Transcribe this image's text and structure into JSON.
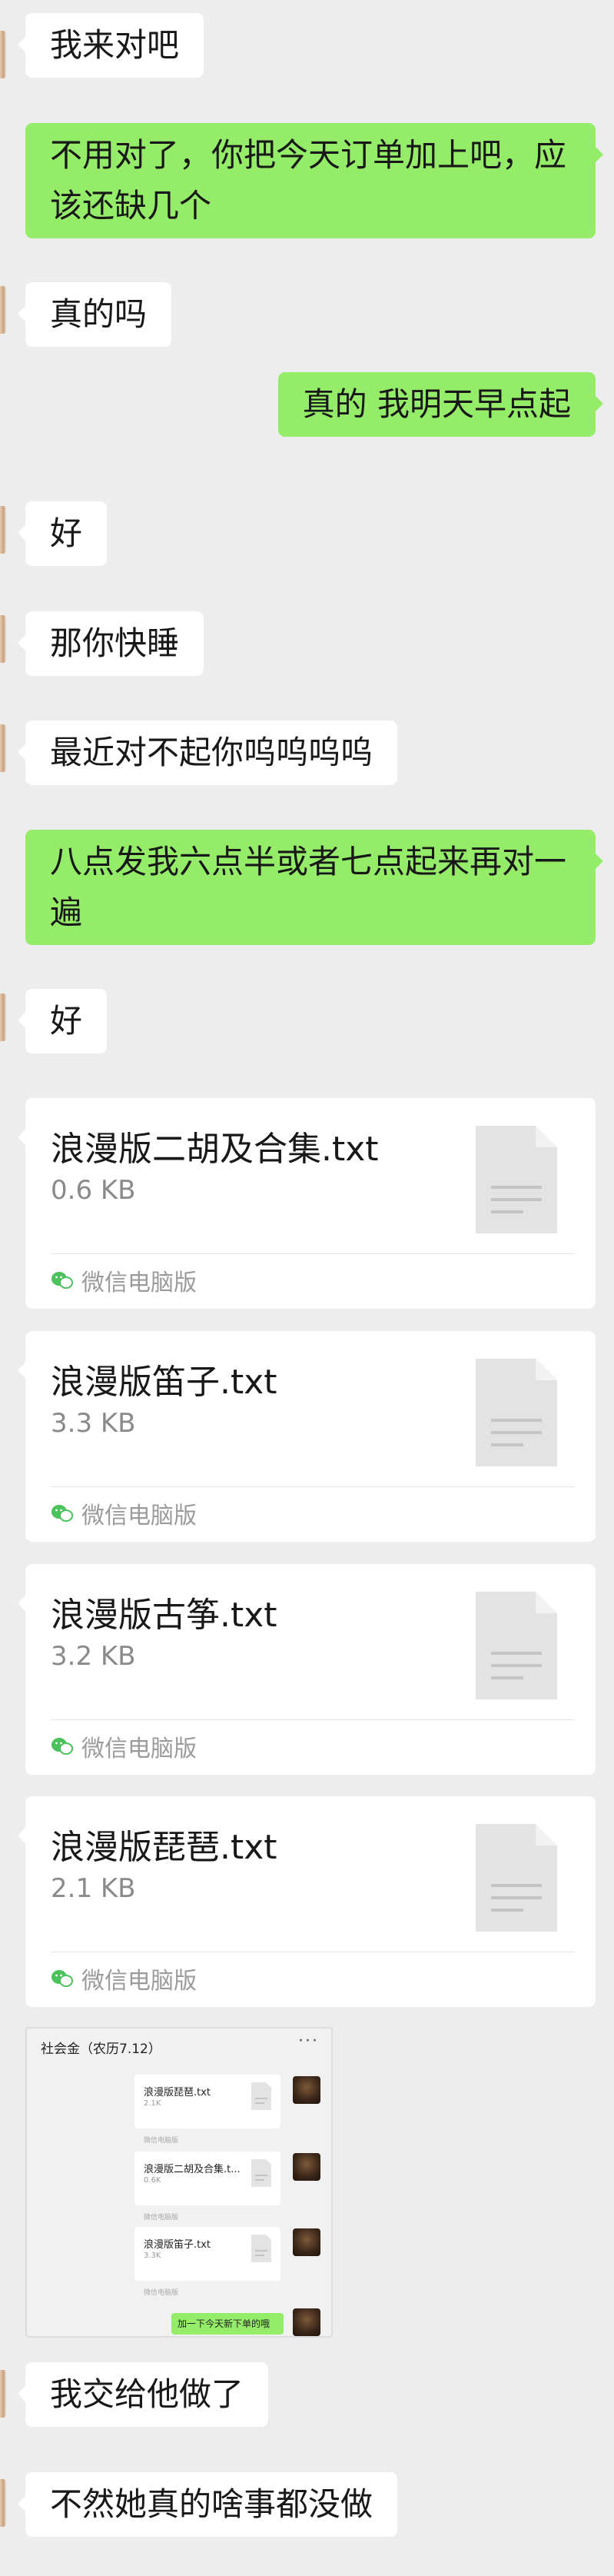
{
  "messages": [
    {
      "text": "我来对吧"
    },
    {
      "text": "不用对了，你把今天订单加上吧，应该还缺几个"
    },
    {
      "text": "真的吗"
    },
    {
      "text": "真的 我明天早点起"
    },
    {
      "text": "好"
    },
    {
      "text": "那你快睡"
    },
    {
      "text": "最近对不起你呜呜呜呜"
    },
    {
      "text": "八点发我六点半或者七点起来再对一遍"
    },
    {
      "text": "好"
    },
    {
      "text": "我交给他做了"
    },
    {
      "text": "不然她真的啥事都没做"
    }
  ],
  "files": [
    {
      "name": "浪漫版二胡及合集.txt",
      "size": "0.6 KB",
      "source": "微信电脑版"
    },
    {
      "name": "浪漫版笛子.txt",
      "size": "3.3 KB",
      "source": "微信电脑版"
    },
    {
      "name": "浪漫版古筝.txt",
      "size": "3.2 KB",
      "source": "微信电脑版"
    },
    {
      "name": "浪漫版琵琶.txt",
      "size": "2.1 KB",
      "source": "微信电脑版"
    }
  ],
  "screenshot": {
    "title": "社会金（农历7.12）",
    "more": "···",
    "cards": [
      {
        "name": "浪漫版琵琶.txt",
        "size": "2.1K",
        "source": "微信电脑版"
      },
      {
        "name": "浪漫版二胡及合集.t...",
        "size": "0.6K",
        "source": "微信电脑版"
      },
      {
        "name": "浪漫版笛子.txt",
        "size": "3.3K",
        "source": "微信电脑版"
      }
    ],
    "green_text": "加一下今天新下单的哦"
  },
  "colors": {
    "background": "#ededed",
    "incoming_bubble": "#ffffff",
    "outgoing_bubble": "#95ec69"
  }
}
